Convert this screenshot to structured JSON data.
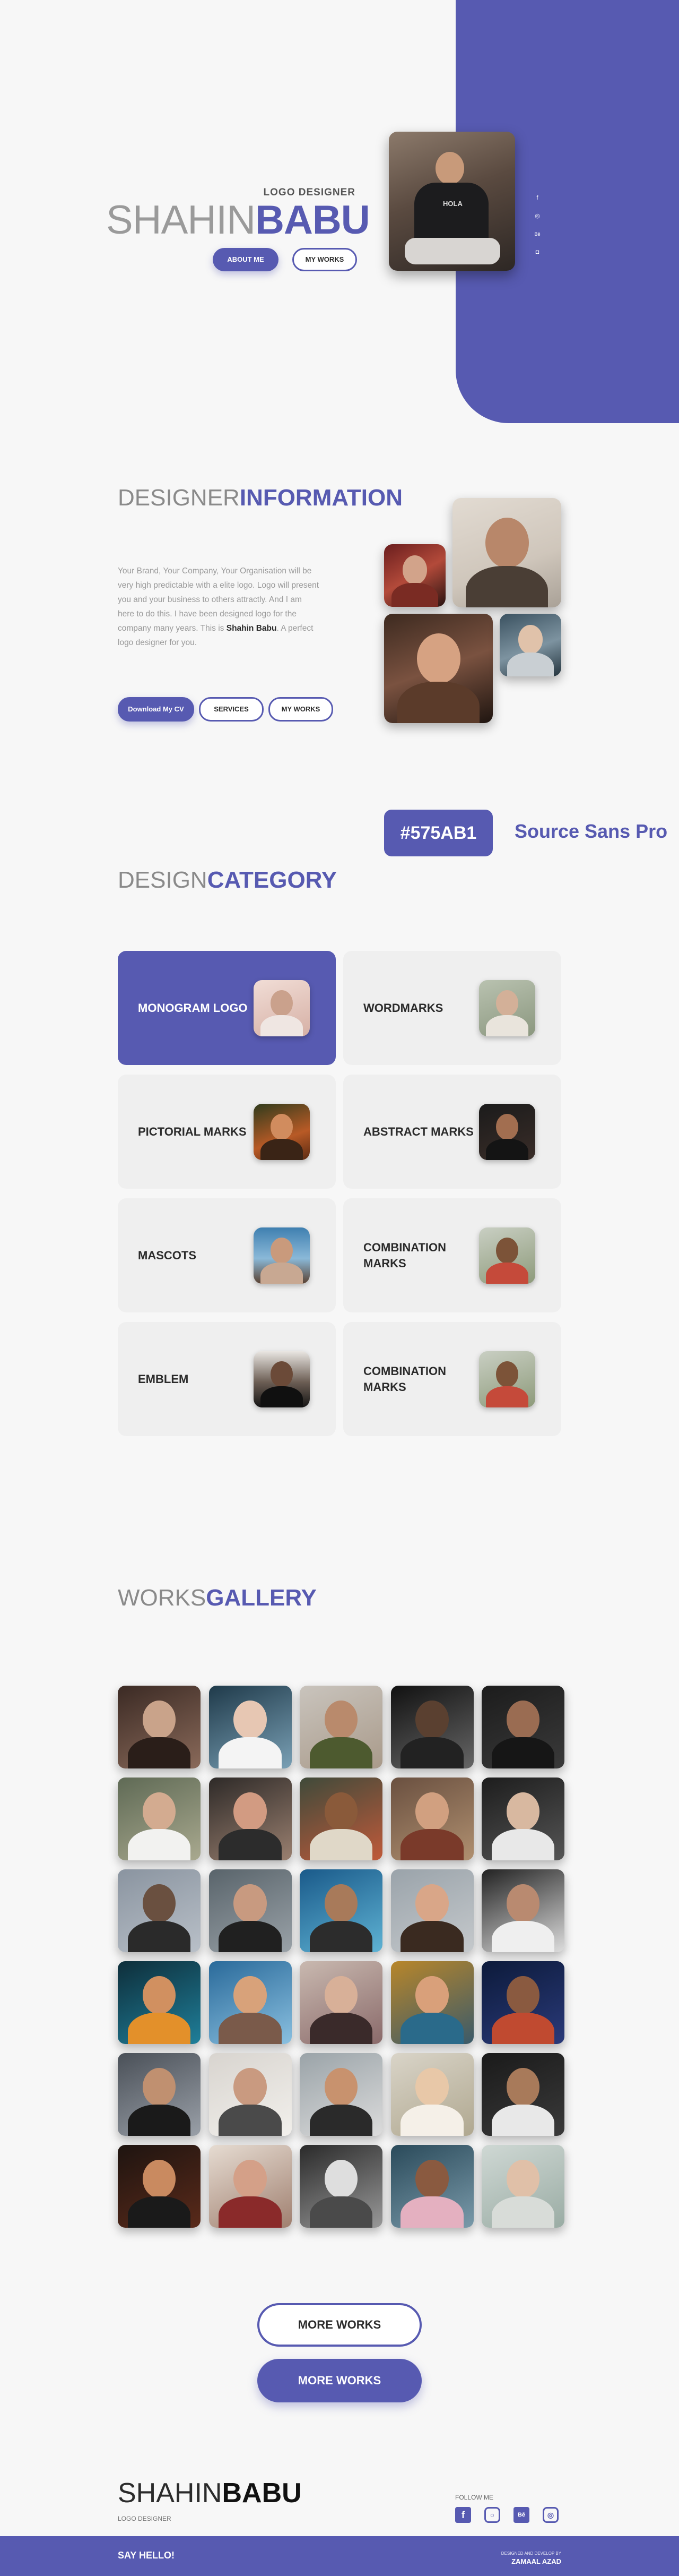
{
  "colors": {
    "accent": "#575AB1",
    "background": "#f7f7f7",
    "card": "#efefef"
  },
  "hero": {
    "role": "LOGO DESIGNER",
    "name_thin": "SHAHIN",
    "name_bold": "BABU",
    "about_button": "ABOUT ME",
    "works_button": "MY WORKS",
    "social_icons": [
      "facebook-icon",
      "dribbble-icon",
      "behance-icon",
      "instagram-icon"
    ]
  },
  "info": {
    "title_thin": "DESIGNER",
    "title_bold": "INFORMATION",
    "text_1": "Your Brand, Your Company, Your Organisation will be very high predictable with a elite logo. Logo will present you and your business to others attractly. And I am here to do this. I have been designed logo for the company many years. This is ",
    "text_name": "Shahin Babu",
    "text_2": ". A perfect logo designer for you.",
    "download_button": "Download My CV",
    "services_button": "SERVICES",
    "works_button": "MY WORKS"
  },
  "brand": {
    "color_code": "#575AB1",
    "font_name": "Source Sans Pro"
  },
  "category": {
    "title_thin": "DESIGN",
    "title_bold": "CATEGORY",
    "items": [
      {
        "label": "MONOGRAM LOGO",
        "active": true
      },
      {
        "label": "WORDMARKS",
        "active": false
      },
      {
        "label": "PICTORIAL MARKS",
        "active": false
      },
      {
        "label": "ABSTRACT MARKS",
        "active": false
      },
      {
        "label": "MASCOTS",
        "active": false
      },
      {
        "label": "COMBINATION MARKS",
        "active": false
      },
      {
        "label": "EMBLEM",
        "active": false
      },
      {
        "label": "COMBINATION MARKS",
        "active": false
      }
    ]
  },
  "gallery": {
    "title_thin": "WORKS",
    "title_bold": "GALLERY",
    "count": 30
  },
  "more": {
    "outline_label": "MORE WORKS",
    "filled_label": "MORE WORKS"
  },
  "footer": {
    "name_thin": "SHAHIN",
    "name_bold": "BABU",
    "role": "LOGO DESIGNER",
    "follow_label": "FOLLOW ME",
    "social_icons": [
      "facebook-icon",
      "instagram-icon",
      "behance-icon",
      "dribbble-icon"
    ],
    "say_hello": "SAY HELLO!",
    "credit_small": "DESIGNED AND DEVELOP BY",
    "credit_name": "ZAMAAL AZAD"
  }
}
